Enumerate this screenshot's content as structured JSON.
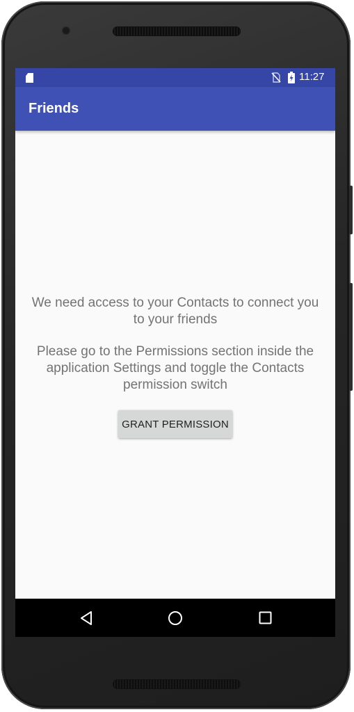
{
  "status_bar": {
    "time": "11:27",
    "icons": [
      "sd-card-icon",
      "no-sim-icon",
      "battery-charging-icon"
    ],
    "color": "#3546a6"
  },
  "toolbar": {
    "title": "Friends",
    "color": "#3f51b5"
  },
  "content": {
    "message_line1": "We need access to your Contacts to connect you to your friends",
    "message_line2": "Please go to the Permissions section inside the application Settings and toggle the Contacts permission switch",
    "text_color": "#737373"
  },
  "grant_button": {
    "label": "GRANT PERMISSION",
    "color": "#d6d7d7"
  },
  "nav_bar": {
    "buttons": [
      "back-icon",
      "home-icon",
      "recents-icon"
    ]
  }
}
